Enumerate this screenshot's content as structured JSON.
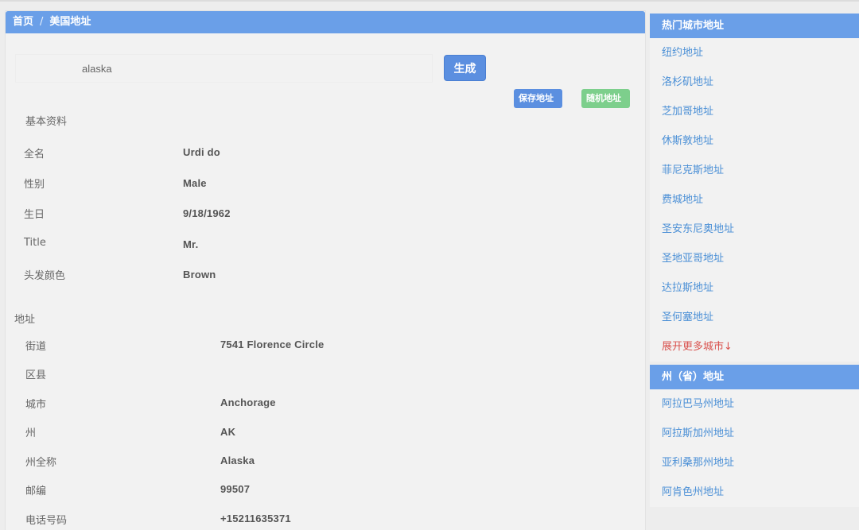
{
  "breadcrumb": {
    "home": "首页",
    "separator": "/",
    "current": "美国地址"
  },
  "search": {
    "value": "alaska",
    "generate_label": "生成"
  },
  "actions": {
    "save_label": "保存地址",
    "random_label": "随机地址"
  },
  "basic": {
    "title": "基本资料",
    "rows": [
      {
        "label": "全名",
        "value": "Urdi do"
      },
      {
        "label": "性别",
        "value": "Male"
      },
      {
        "label": "生日",
        "value": "9/18/1962"
      },
      {
        "label": "Title",
        "value": "Mr."
      },
      {
        "label": "头发颜色",
        "value": "Brown"
      }
    ]
  },
  "address": {
    "title": "地址",
    "rows": [
      {
        "label": "街道",
        "value": "7541 Florence Circle"
      },
      {
        "label": "区县",
        "value": ""
      },
      {
        "label": "城市",
        "value": "Anchorage"
      },
      {
        "label": "州",
        "value": "AK"
      },
      {
        "label": "州全称",
        "value": "Alaska"
      },
      {
        "label": "邮编",
        "value": "99507"
      },
      {
        "label": "电话号码",
        "value": "+15211635371"
      }
    ]
  },
  "sidebar": {
    "cities_title": "热门城市地址",
    "cities": [
      "纽约地址",
      "洛杉矶地址",
      "芝加哥地址",
      "休斯敦地址",
      "菲尼克斯地址",
      "费城地址",
      "圣安东尼奥地址",
      "圣地亚哥地址",
      "达拉斯地址",
      "圣何塞地址"
    ],
    "more_label": "展开更多城市↓",
    "states_title": "州（省）地址",
    "states": [
      "阿拉巴马州地址",
      "阿拉斯加州地址",
      "亚利桑那州地址",
      "阿肯色州地址"
    ]
  },
  "colors": {
    "header": "#6a9fe8",
    "link": "#4a8fd6",
    "more_link": "#d9534f",
    "save": "#5b8fe0",
    "random": "#7dcf8c"
  }
}
